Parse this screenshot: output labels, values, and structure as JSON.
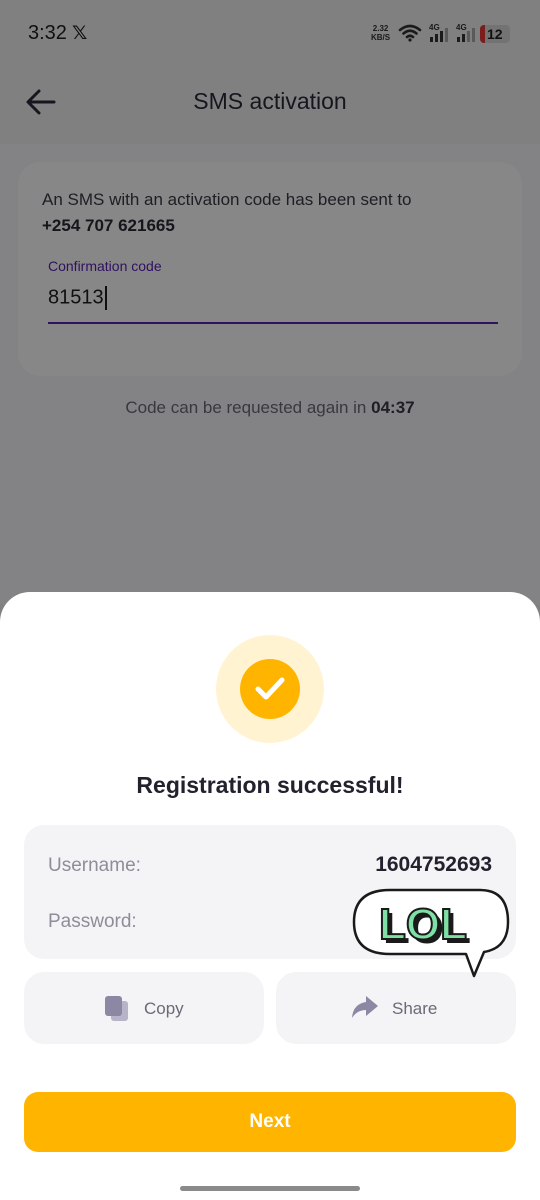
{
  "status_bar": {
    "time": "3:32",
    "app_icon": "x-logo-icon",
    "net_speed_value": "2.32",
    "net_speed_unit": "KB/S",
    "signal_1_label": "4G",
    "signal_2_label": "4G",
    "battery_level": "12"
  },
  "app_bar": {
    "back_icon": "arrow-left-icon",
    "title": "SMS activation"
  },
  "sms_card": {
    "message": "An SMS with an activation code has been sent to",
    "phone": "+254 707 621665",
    "code_label": "Confirmation code",
    "code_value": "81513"
  },
  "resend": {
    "text": "Code can be requested again in ",
    "timer": "04:37"
  },
  "sheet": {
    "icon": "checkmark-circle-icon",
    "title": "Registration successful!",
    "credentials": {
      "username_label": "Username:",
      "username_value": "1604752693",
      "password_label": "Password:"
    },
    "copy_button": {
      "icon": "copy-icon",
      "label": "Copy"
    },
    "share_button": {
      "icon": "share-arrow-icon",
      "label": "Share"
    },
    "sticker": {
      "icon": "lol-sticker",
      "text": "LOL"
    },
    "next_button": "Next"
  },
  "colors": {
    "accent": "#ffb400",
    "primary_purple": "#5b1fb8",
    "sticker_green": "#7ee0a5",
    "sticker_purple": "#9b6cf0"
  }
}
